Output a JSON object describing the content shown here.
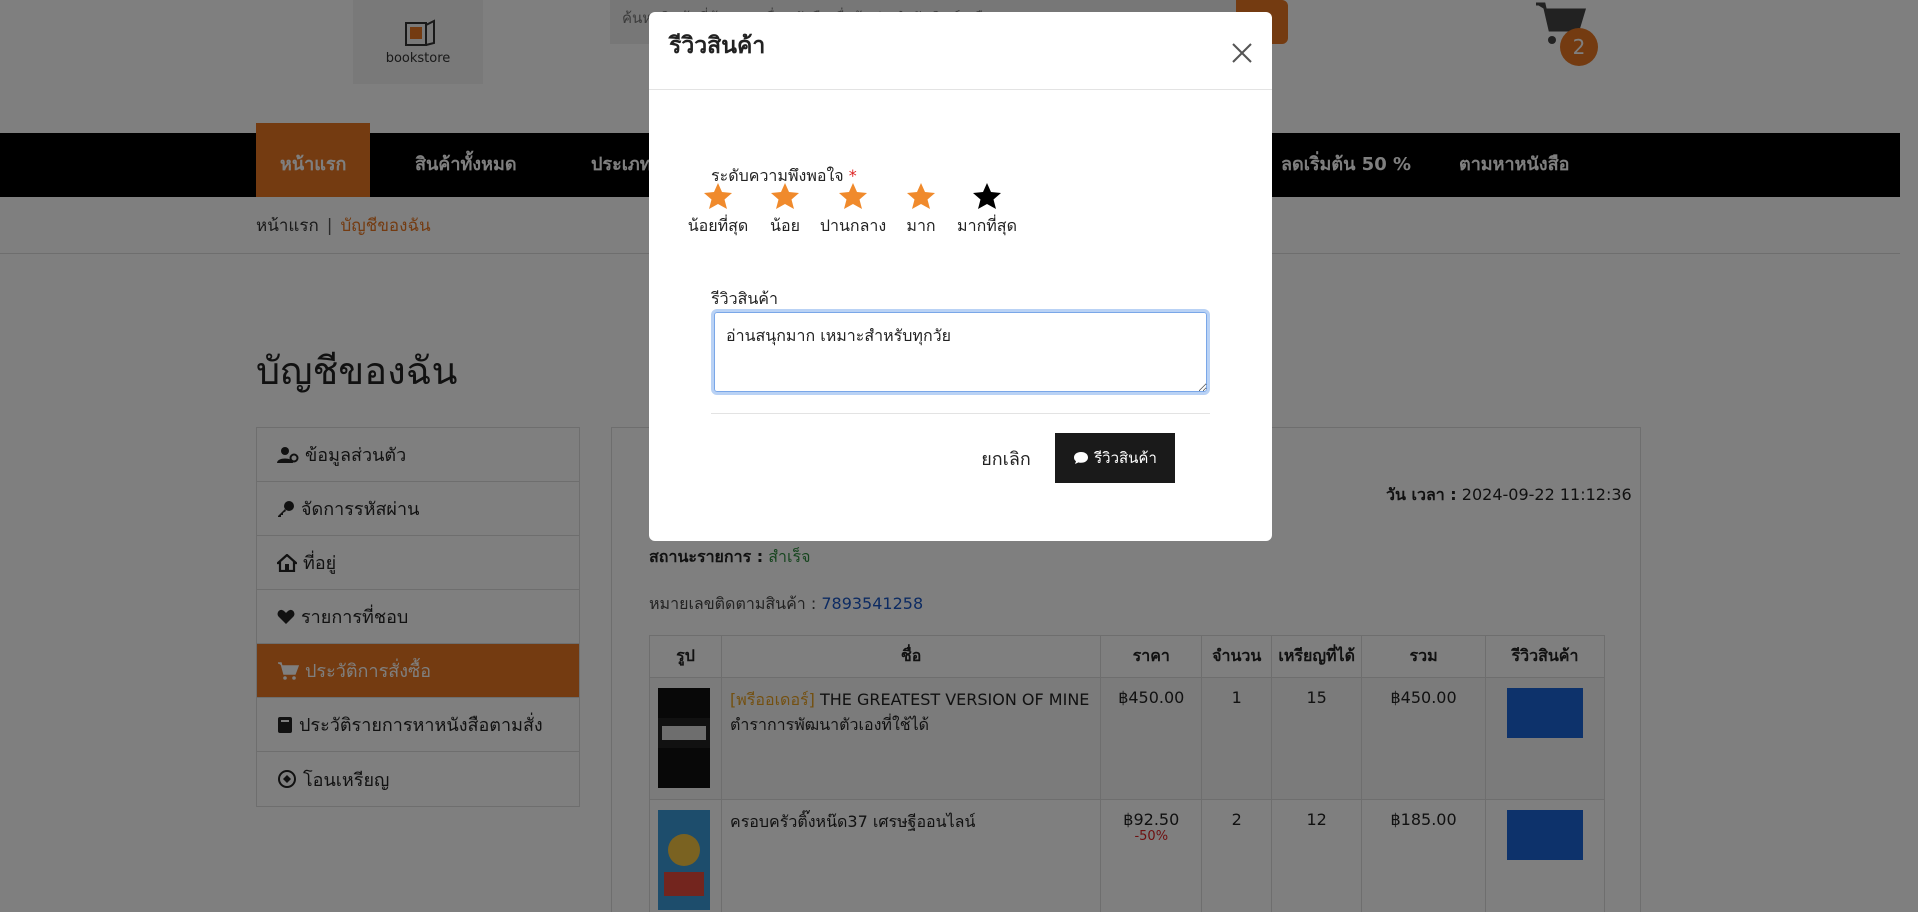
{
  "header": {
    "logo_text": "bookstore",
    "search_placeholder": "ค้นหาสินค้าที่ต้องการ ชื่อหนังสือ ชื่อผู้แต่ง สำนักพิมพ์ หรือ ISBN",
    "cart_count": "2"
  },
  "nav": {
    "items": [
      {
        "label": "หน้าแรก"
      },
      {
        "label": "สินค้าทั้งหมด"
      },
      {
        "label": "ประเภท"
      },
      {
        "label": "ลดเริ่มต้น 50 %"
      },
      {
        "label": "ตามหาหนังสือ"
      }
    ]
  },
  "breadcrumb": {
    "home": "หน้าแรก",
    "separator": "|",
    "current": "บัญชีของฉัน"
  },
  "account": {
    "title": "บัญชีของฉัน",
    "menu": [
      {
        "label": "ข้อมูลส่วนตัว",
        "icon": "user-gear-icon"
      },
      {
        "label": "จัดการรหัสผ่าน",
        "icon": "key-icon"
      },
      {
        "label": "ที่อยู่",
        "icon": "home-icon"
      },
      {
        "label": "รายการที่ชอบ",
        "icon": "heart-icon"
      },
      {
        "label": "ประวัติการสั่งซื้อ",
        "icon": "cart-icon",
        "active": true
      },
      {
        "label": "ประวัติรายการหาหนังสือตามสั่ง",
        "icon": "book-icon"
      },
      {
        "label": "โอนเหรียญ",
        "icon": "coin-icon"
      }
    ]
  },
  "order": {
    "date_label": "วัน เวลา :",
    "date_value": "2024-09-22 11:12:36",
    "status_label": "สถานะรายการ :",
    "status_value": "สำเร็จ",
    "tracking_label": "หมายเลขติดตามสินค้า :",
    "tracking_value": "7893541258",
    "columns": [
      "รูป",
      "ชื่อ",
      "ราคา",
      "จำนวน",
      "เหรียญที่ได้",
      "รวม",
      "รีวิวสินค้า"
    ],
    "rows": [
      {
        "promo": "[พรีออเดอร์]",
        "name": "THE GREATEST VERSION OF MINE ตำราการพัฒนาตัวเองที่ใช้ได้",
        "price": "฿450.00",
        "discount": "",
        "qty": "1",
        "coins": "15",
        "total": "฿450.00"
      },
      {
        "promo": "",
        "name": "ครอบครัวติ๊งหน๊ด37 เศรษฐีออนไลน์",
        "price": "฿92.50",
        "discount": "-50%",
        "qty": "2",
        "coins": "12",
        "total": "฿185.00"
      }
    ]
  },
  "modal": {
    "title": "รีวิวสินค้า",
    "rating_label": "ระดับความพึงพอใจ",
    "required_mark": "*",
    "ratings": [
      {
        "label": "น้อยที่สุด",
        "selected": true
      },
      {
        "label": "น้อย",
        "selected": true
      },
      {
        "label": "ปานกลาง",
        "selected": true
      },
      {
        "label": "มาก",
        "selected": true
      },
      {
        "label": "มากที่สุด",
        "selected": false
      }
    ],
    "rating_value": 4,
    "review_label": "รีวิวสินค้า",
    "review_value": "อ่านสนุกมาก เหมาะสำหรับทุกวัย",
    "cancel_label": "ยกเลิก",
    "submit_label": "รีวิวสินค้า"
  },
  "colors": {
    "accent": "#e87722",
    "dark": "#1a1a1a",
    "review_button": "#1a64d6",
    "success": "#2e8b3e"
  }
}
